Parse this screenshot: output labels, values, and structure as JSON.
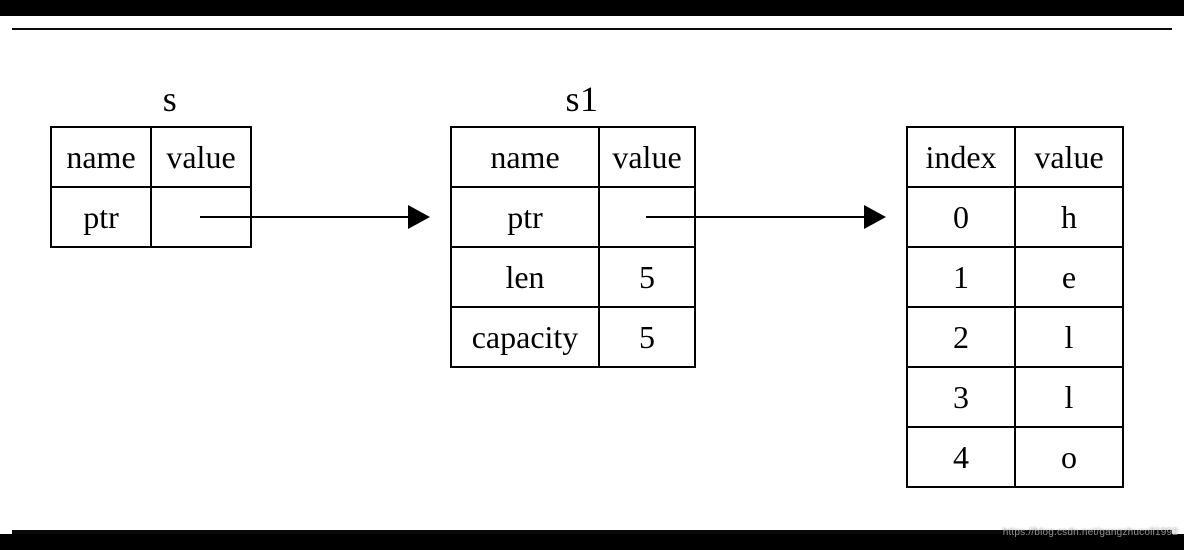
{
  "titles": {
    "s": "s",
    "s1": "s1"
  },
  "table_s": {
    "headers": {
      "name": "name",
      "value": "value"
    },
    "row_ptr": {
      "name": "ptr",
      "value": ""
    }
  },
  "table_s1": {
    "headers": {
      "name": "name",
      "value": "value"
    },
    "rows": {
      "ptr": {
        "name": "ptr",
        "value": ""
      },
      "len": {
        "name": "len",
        "value": "5"
      },
      "capacity": {
        "name": "capacity",
        "value": "5"
      }
    }
  },
  "table_heap": {
    "headers": {
      "index": "index",
      "value": "value"
    },
    "rows": [
      {
        "index": "0",
        "value": "h"
      },
      {
        "index": "1",
        "value": "e"
      },
      {
        "index": "2",
        "value": "l"
      },
      {
        "index": "3",
        "value": "l"
      },
      {
        "index": "4",
        "value": "o"
      }
    ]
  },
  "watermark": "https://blog.csdn.net/gangzhucoll1992",
  "chart_data": {
    "type": "table",
    "description": "Memory layout diagram: variable s holds a pointer to String s1; s1 has fields ptr, len=5, capacity=5; s1.ptr points to a heap buffer of 5 bytes spelling 'hello' at indices 0..4.",
    "nodes": [
      {
        "id": "s",
        "label": "s",
        "columns": [
          "name",
          "value"
        ],
        "rows": [
          [
            "ptr",
            "→ s1"
          ]
        ]
      },
      {
        "id": "s1",
        "label": "s1",
        "columns": [
          "name",
          "value"
        ],
        "rows": [
          [
            "ptr",
            "→ heap"
          ],
          [
            "len",
            5
          ],
          [
            "capacity",
            5
          ]
        ]
      },
      {
        "id": "heap",
        "label": "",
        "columns": [
          "index",
          "value"
        ],
        "rows": [
          [
            0,
            "h"
          ],
          [
            1,
            "e"
          ],
          [
            2,
            "l"
          ],
          [
            3,
            "l"
          ],
          [
            4,
            "o"
          ]
        ]
      }
    ],
    "edges": [
      {
        "from": "s.ptr",
        "to": "s1"
      },
      {
        "from": "s1.ptr",
        "to": "heap"
      }
    ]
  }
}
